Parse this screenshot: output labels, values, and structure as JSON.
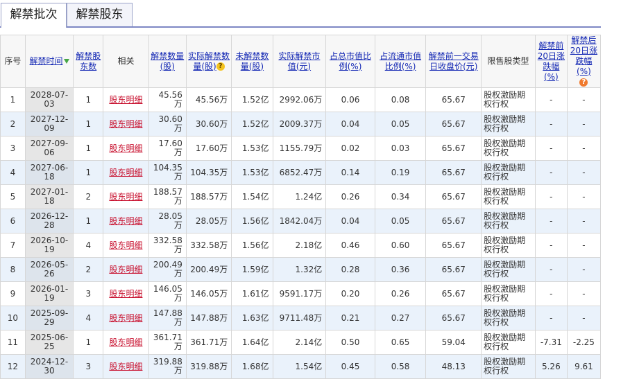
{
  "tabs": [
    {
      "label": "解禁批次",
      "active": true
    },
    {
      "label": "解禁股东",
      "active": false
    }
  ],
  "headers": {
    "seq": "序号",
    "time": "解禁时间",
    "holders": "解禁股东数",
    "related": "相关",
    "qty": "解禁数量(股)",
    "actual_qty": "实际解禁数量(股)",
    "unlocked_qty": "未解禁数量(股)",
    "actual_value": "实际解禁市值(元)",
    "total_ratio": "占总市值比例(%)",
    "float_ratio": "占流通市值比例(%)",
    "prev_close": "解禁前一交易日收盘价(元)",
    "type": "限售股类型",
    "pre20": "解禁前20日涨跌幅(%)",
    "post20": "解禁后20日涨跌幅(%)"
  },
  "help_icon_text": "?",
  "rows": [
    {
      "seq": "1",
      "date": "2028-07-03",
      "holders": "1",
      "link": "股东明细",
      "qty": "45.56万",
      "actual": "45.56万",
      "remaining": "1.52亿",
      "value": "2992.06万",
      "total": "0.06",
      "float": "0.08",
      "close": "65.67",
      "type": "股权激励期权行权",
      "pre": "-",
      "post": "-"
    },
    {
      "seq": "2",
      "date": "2027-12-09",
      "holders": "1",
      "link": "股东明细",
      "qty": "30.60万",
      "actual": "30.60万",
      "remaining": "1.52亿",
      "value": "2009.37万",
      "total": "0.04",
      "float": "0.05",
      "close": "65.67",
      "type": "股权激励期权行权",
      "pre": "-",
      "post": "-"
    },
    {
      "seq": "3",
      "date": "2027-09-06",
      "holders": "1",
      "link": "股东明细",
      "qty": "17.60万",
      "actual": "17.60万",
      "remaining": "1.53亿",
      "value": "1155.79万",
      "total": "0.02",
      "float": "0.03",
      "close": "65.67",
      "type": "股权激励期权行权",
      "pre": "-",
      "post": "-"
    },
    {
      "seq": "4",
      "date": "2027-06-18",
      "holders": "1",
      "link": "股东明细",
      "qty": "104.35万",
      "actual": "104.35万",
      "remaining": "1.53亿",
      "value": "6852.47万",
      "total": "0.14",
      "float": "0.19",
      "close": "65.67",
      "type": "股权激励期权行权",
      "pre": "-",
      "post": "-"
    },
    {
      "seq": "5",
      "date": "2027-01-18",
      "holders": "2",
      "link": "股东明细",
      "qty": "188.57万",
      "actual": "188.57万",
      "remaining": "1.54亿",
      "value": "1.24亿",
      "total": "0.26",
      "float": "0.34",
      "close": "65.67",
      "type": "股权激励期权行权",
      "pre": "-",
      "post": "-"
    },
    {
      "seq": "6",
      "date": "2026-12-28",
      "holders": "1",
      "link": "股东明细",
      "qty": "28.05万",
      "actual": "28.05万",
      "remaining": "1.56亿",
      "value": "1842.04万",
      "total": "0.04",
      "float": "0.05",
      "close": "65.67",
      "type": "股权激励期权行权",
      "pre": "-",
      "post": "-"
    },
    {
      "seq": "7",
      "date": "2026-10-19",
      "holders": "4",
      "link": "股东明细",
      "qty": "332.58万",
      "actual": "332.58万",
      "remaining": "1.56亿",
      "value": "2.18亿",
      "total": "0.46",
      "float": "0.60",
      "close": "65.67",
      "type": "股权激励期权行权",
      "pre": "-",
      "post": "-"
    },
    {
      "seq": "8",
      "date": "2026-05-26",
      "holders": "2",
      "link": "股东明细",
      "qty": "200.49万",
      "actual": "200.49万",
      "remaining": "1.59亿",
      "value": "1.32亿",
      "total": "0.28",
      "float": "0.36",
      "close": "65.67",
      "type": "股权激励期权行权",
      "pre": "-",
      "post": "-"
    },
    {
      "seq": "9",
      "date": "2026-01-19",
      "holders": "3",
      "link": "股东明细",
      "qty": "146.05万",
      "actual": "146.05万",
      "remaining": "1.61亿",
      "value": "9591.17万",
      "total": "0.20",
      "float": "0.26",
      "close": "65.67",
      "type": "股权激励期权行权",
      "pre": "-",
      "post": "-"
    },
    {
      "seq": "10",
      "date": "2025-09-29",
      "holders": "4",
      "link": "股东明细",
      "qty": "147.88万",
      "actual": "147.88万",
      "remaining": "1.63亿",
      "value": "9711.48万",
      "total": "0.21",
      "float": "0.27",
      "close": "65.67",
      "type": "股权激励期权行权",
      "pre": "-",
      "post": "-"
    },
    {
      "seq": "11",
      "date": "2025-06-25",
      "holders": "1",
      "link": "股东明细",
      "qty": "361.71万",
      "actual": "361.71万",
      "remaining": "1.64亿",
      "value": "2.14亿",
      "total": "0.50",
      "float": "0.65",
      "close": "59.04",
      "type": "股权激励期权行权",
      "pre": "-7.31",
      "post": "-2.25",
      "pre_sign": "down",
      "post_sign": "down"
    },
    {
      "seq": "12",
      "date": "2024-12-30",
      "holders": "3",
      "link": "股东明细",
      "qty": "319.88万",
      "actual": "319.88万",
      "remaining": "1.68亿",
      "value": "1.54亿",
      "total": "0.45",
      "float": "0.58",
      "close": "48.13",
      "type": "股权激励期权行权",
      "pre": "5.26",
      "post": "9.61",
      "pre_sign": "up",
      "post_sign": "up"
    }
  ]
}
